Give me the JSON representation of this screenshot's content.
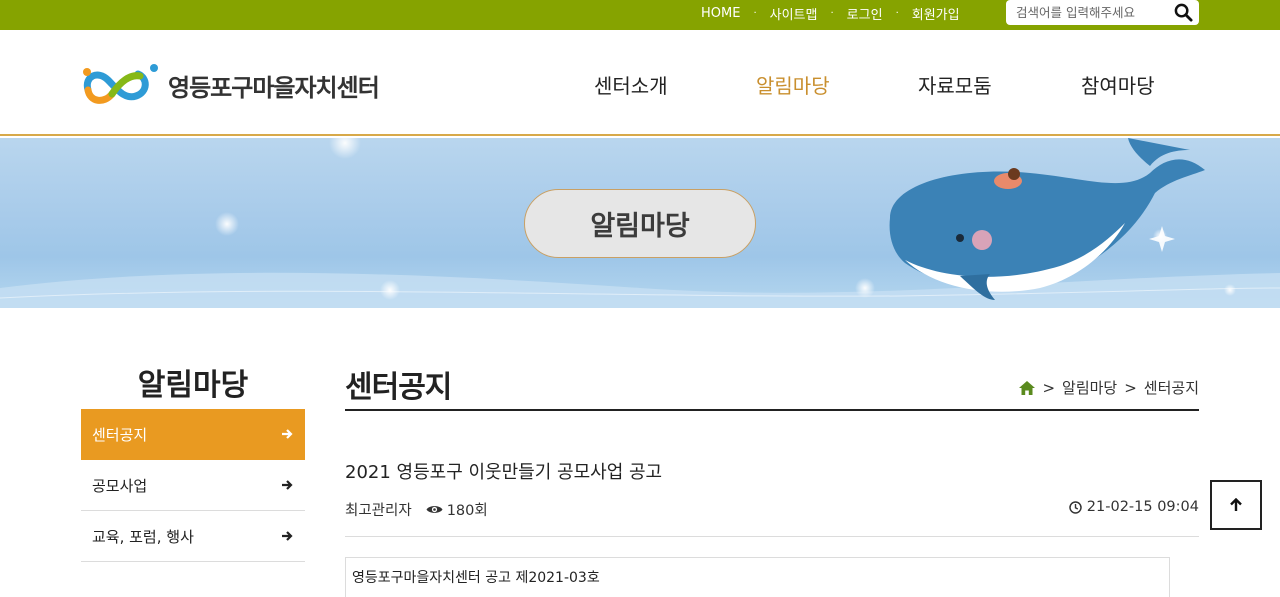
{
  "util_links": {
    "home": "HOME",
    "sitemap": "사이트맵",
    "login": "로그인",
    "join": "회원가입",
    "separator": "·"
  },
  "search": {
    "placeholder": "검색어를 입력해주세요",
    "icon": "search-icon"
  },
  "logo": {
    "text": "영등포구마을자치센터"
  },
  "gnb": [
    {
      "label": "센터소개",
      "active": false
    },
    {
      "label": "알림마당",
      "active": true
    },
    {
      "label": "자료모둠",
      "active": false
    },
    {
      "label": "참여마당",
      "active": false
    }
  ],
  "banner": {
    "title": "알림마당"
  },
  "sidebar": {
    "title": "알림마당",
    "items": [
      {
        "label": "센터공지",
        "active": true
      },
      {
        "label": "공모사업",
        "active": false
      },
      {
        "label": "교육, 포럼, 행사",
        "active": false
      }
    ]
  },
  "content": {
    "title": "센터공지",
    "breadcrumb": [
      "알림마당",
      "센터공지"
    ],
    "breadcrumb_separator": ">",
    "post": {
      "title": "2021 영등포구 이웃만들기 공모사업 공고",
      "author": "최고관리자",
      "views": "180회",
      "date": "21-02-15 09:04",
      "body_preview": "영등포구마을자치센터 공고 제2021-03호"
    }
  },
  "colors": {
    "top_bar": "#86a300",
    "accent": "#e99a21",
    "nav_active": "#c98f2e",
    "header_line": "#d7a94a"
  }
}
